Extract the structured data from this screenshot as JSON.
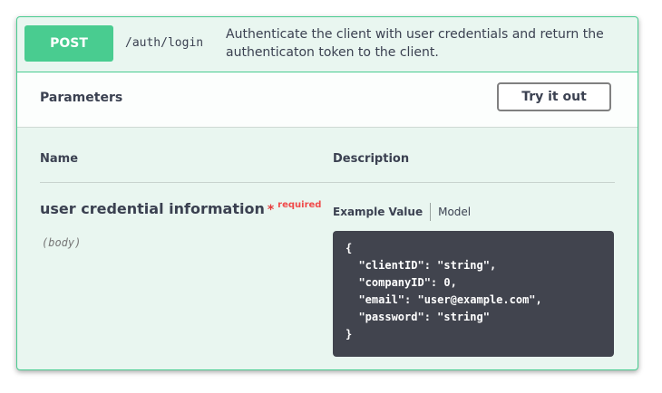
{
  "operation": {
    "method": "POST",
    "path": "/auth/login",
    "description": "Authenticate the client with user credentials and return the authenticaton token to the client."
  },
  "parameters": {
    "title": "Parameters",
    "try_button": "Try it out",
    "columns": {
      "name": "Name",
      "description": "Description"
    },
    "param": {
      "name": "user credential information",
      "required_star": "*",
      "required_label": "required",
      "location": "(body)"
    },
    "tabs": {
      "example": "Example Value",
      "model": "Model"
    },
    "example_value": "{\n  \"clientID\": \"string\",\n  \"companyID\": 0,\n  \"email\": \"user@example.com\",\n  \"password\": \"string\"\n}"
  },
  "colors": {
    "post_green": "#49cc90",
    "background_tint": "#e9f6f0",
    "code_background": "#41444e",
    "required_red": "#f04a4a"
  }
}
